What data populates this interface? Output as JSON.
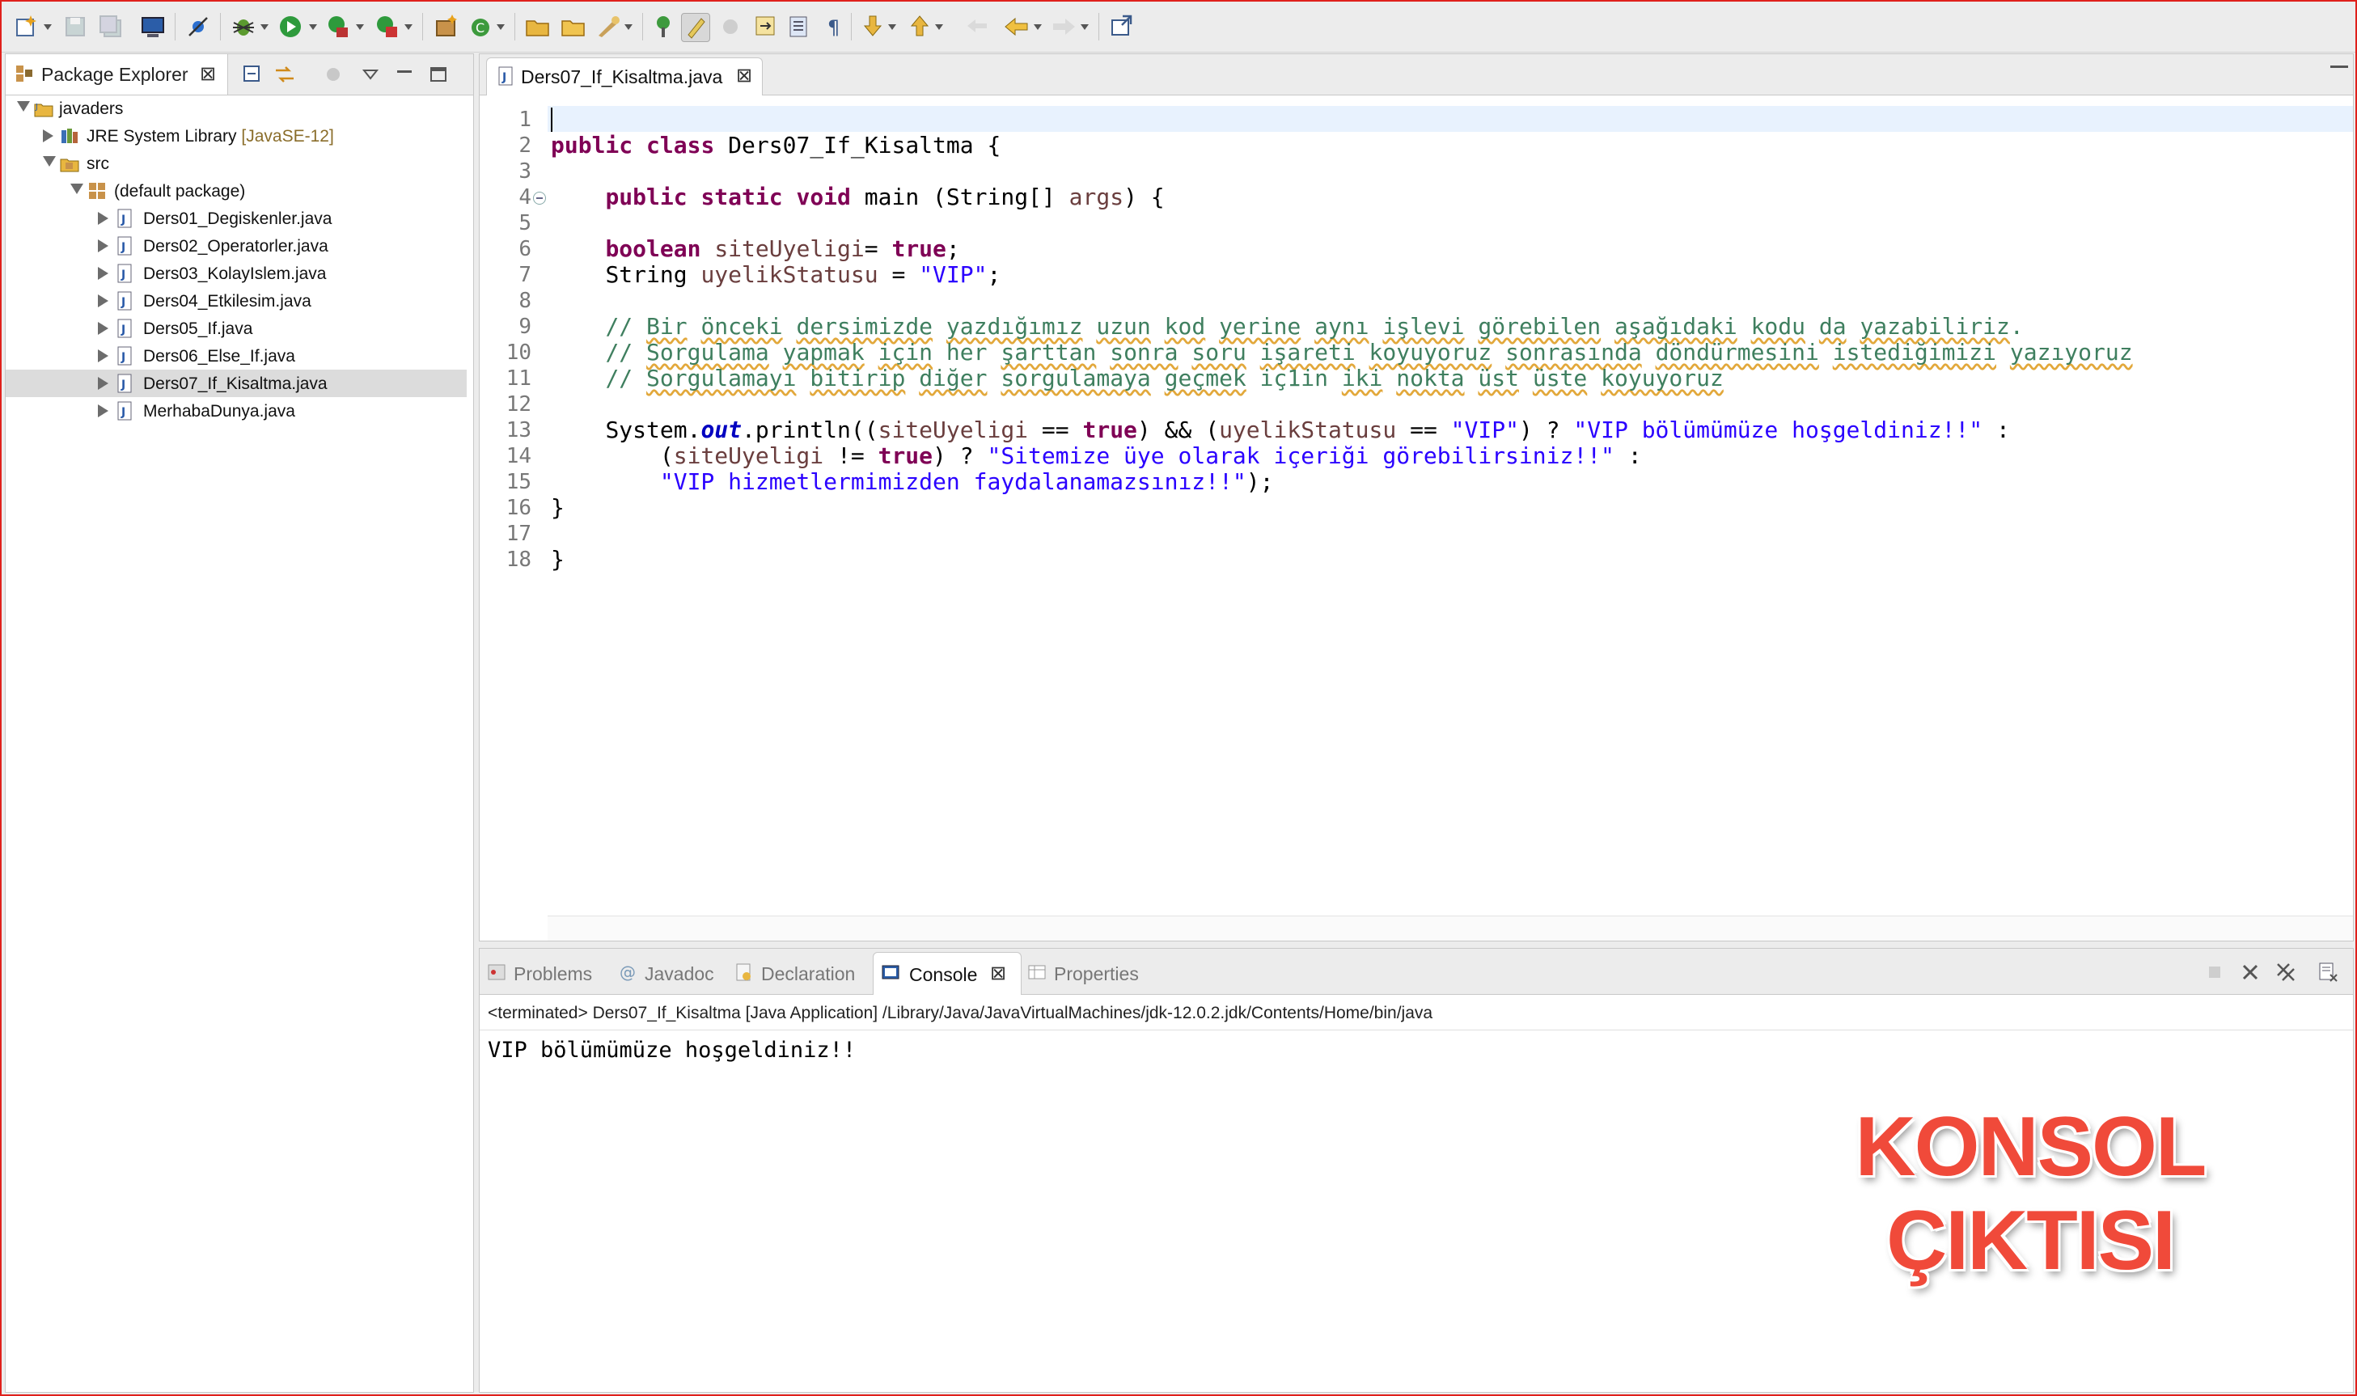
{
  "package_explorer": {
    "tab_label": "Package Explorer",
    "tree": [
      {
        "label": "javaders",
        "icon": "java-project-icon"
      },
      {
        "label": "JRE System Library",
        "decoration": "[JavaSE-12]",
        "icon": "library-icon"
      },
      {
        "label": "src",
        "icon": "source-folder-icon"
      },
      {
        "label": "(default package)",
        "icon": "package-icon"
      },
      {
        "label": "Ders01_Degiskenler.java",
        "icon": "java-file-icon"
      },
      {
        "label": "Ders02_Operatorler.java",
        "icon": "java-file-icon"
      },
      {
        "label": "Ders03_KolayIslem.java",
        "icon": "java-file-icon"
      },
      {
        "label": "Ders04_Etkilesim.java",
        "icon": "java-file-icon"
      },
      {
        "label": "Ders05_If.java",
        "icon": "java-file-icon"
      },
      {
        "label": "Ders06_Else_If.java",
        "icon": "java-file-icon"
      },
      {
        "label": "Ders07_If_Kisaltma.java",
        "icon": "java-file-icon",
        "selected": true
      },
      {
        "label": "MerhabaDunya.java",
        "icon": "java-file-icon"
      }
    ]
  },
  "editor": {
    "tab_label": "Ders07_If_Kisaltma.java",
    "line_numbers": [
      "1",
      "2",
      "3",
      "4",
      "5",
      "6",
      "7",
      "8",
      "9",
      "10",
      "11",
      "12",
      "13",
      "14",
      "15",
      "16",
      "17",
      "18"
    ],
    "code": {
      "l2": {
        "kw1": "public",
        "kw2": "class",
        "rest": " Ders07_If_Kisaltma {"
      },
      "l4": {
        "indent": "    ",
        "kw1": "public",
        "kw2": "static",
        "kw3": "void",
        "rest1": " main (String[] ",
        "var": "args",
        "rest2": ") {"
      },
      "l6": {
        "indent": "    ",
        "kw": "boolean",
        "sp": " ",
        "var": "siteUyeligi",
        "mid": "= ",
        "kw2": "true",
        "end": ";"
      },
      "l7": {
        "indent": "    ",
        "type": "String ",
        "var": "uyelikStatusu",
        "mid": " = ",
        "str": "\"VIP\"",
        "end": ";"
      },
      "l9": {
        "indent": "    ",
        "prefix": "// ",
        "words": [
          "Bir",
          " ",
          "önceki",
          " ",
          "dersimizde",
          " ",
          "yazdığımız",
          " ",
          "uzun",
          " ",
          "kod",
          " ",
          "yerine",
          " ",
          "aynı",
          " ",
          "işlevi",
          " ",
          "görebilen",
          " ",
          "aşağıdaki",
          " ",
          "kodu",
          " ",
          "da",
          " ",
          "yazabiliriz",
          "."
        ]
      },
      "l10": {
        "indent": "    ",
        "prefix": "// ",
        "words": [
          "Sorgulama",
          " ",
          "yapmak",
          " ",
          "için",
          " her ",
          "şarttan",
          " ",
          "sonra",
          " ",
          "soru",
          " ",
          "işareti",
          " ",
          "koyuyoruz",
          " ",
          "sonrasında",
          " ",
          "döndürmesini",
          " ",
          "istediğimizi",
          " ",
          "yazıyoruz"
        ]
      },
      "l11": {
        "indent": "    ",
        "prefix": "// ",
        "words": [
          "Sorgulamayı",
          " ",
          "bitirip",
          " ",
          "diğer",
          " ",
          "sorgulamaya",
          " ",
          "geçmek",
          " iç1in ",
          "iki",
          " ",
          "nokta",
          " ",
          "üst",
          " ",
          "üste",
          " ",
          "koyuyoruz"
        ]
      },
      "l13": {
        "indent": "    ",
        "a": "System.",
        "fld": "out",
        "b": ".println((",
        "var1": "siteUyeligi",
        "c": " == ",
        "kw1": "true",
        "d": ") && (",
        "var2": "uyelikStatusu",
        "e": " == ",
        "str1": "\"VIP\"",
        "f": ") ? ",
        "str2": "\"VIP bölümümüze hoşgeldiniz!!\"",
        "g": " :"
      },
      "l14": {
        "indent": "        ",
        "a": "(",
        "var": "siteUyeligi",
        "b": " != ",
        "kw": "true",
        "c": ") ? ",
        "str": "\"Sitemize üye olarak içeriği görebilirsiniz!!\"",
        "d": " :"
      },
      "l15": {
        "indent": "        ",
        "str": "\"VIP hizmetlermimizden faydalanamazsınız!!\"",
        "end": ");"
      },
      "l16": {
        "text": "}"
      },
      "l18": {
        "text": "}"
      }
    }
  },
  "bottom_panel": {
    "tabs": [
      {
        "label": "Problems",
        "icon": "problems-icon"
      },
      {
        "label": "Javadoc",
        "icon": "javadoc-icon"
      },
      {
        "label": "Declaration",
        "icon": "declaration-icon"
      },
      {
        "label": "Console",
        "icon": "console-icon",
        "active": true
      },
      {
        "label": "Properties",
        "icon": "properties-icon"
      }
    ],
    "terminated_line": "<terminated> Ders07_If_Kisaltma [Java Application] /Library/Java/JavaVirtualMachines/jdk-12.0.2.jdk/Contents/Home/bin/java",
    "console_output": "VIP bölümümüze hoşgeldiniz!!"
  },
  "overlay": {
    "line1": "KONSOL",
    "line2": "ÇIKTISI",
    "color": "#f04a3a"
  },
  "colors": {
    "keyword": "#7f0055",
    "string": "#2a00ff",
    "comment": "#3f7f5f",
    "local_variable": "#6a3e3e",
    "static_field": "#0000c0"
  }
}
